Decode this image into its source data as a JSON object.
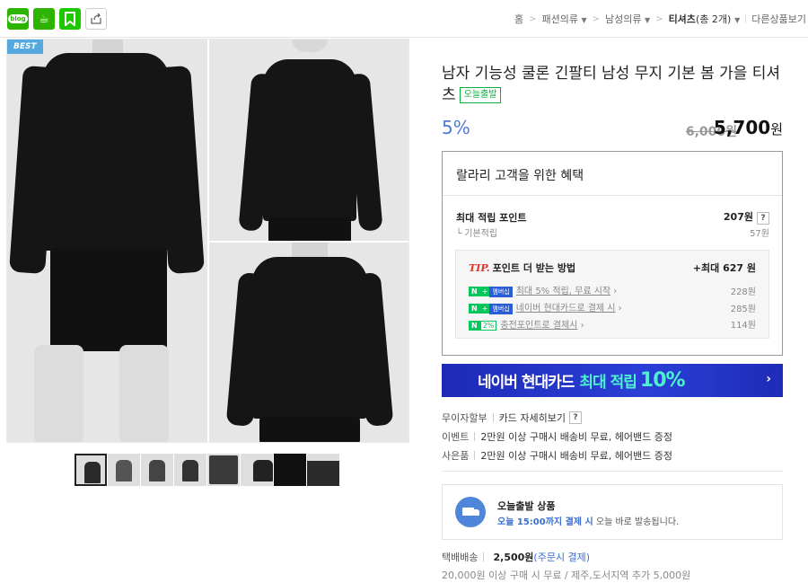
{
  "share": {
    "blog_label": "blog"
  },
  "breadcrumb": {
    "home": "홈",
    "cat1": "패션의류",
    "cat2": "남성의류",
    "cat3": "티셔츠",
    "count": "(총 2개)",
    "other": "다른상품보기"
  },
  "gallery": {
    "badge": "BEST",
    "thumb_count": 8
  },
  "product": {
    "title": "남자 기능성 쿨론 긴팔티 남성 무지 기본 봄 가을 티셔츠",
    "today_badge": "오늘출발",
    "discount": "5%",
    "original_price": "6,000원",
    "price": "5,700",
    "price_unit": "원"
  },
  "benefit": {
    "heading": "랄라리 고객을 위한 혜택",
    "max_points_label": "최대 적립 포인트",
    "max_points_value": "207원",
    "basic_label": "기본적립",
    "basic_value": "57원",
    "tip_label": "TIP.",
    "tip_text": "포인트 더 받는 방법",
    "tip_max": "+최대 627 원",
    "rows": [
      {
        "n": "N",
        "plus": "+",
        "tag": "멤버십",
        "text": "최대 5% 적립, 무료 시작",
        "value": "228원"
      },
      {
        "n": "N",
        "plus": "+",
        "tag": "멤버십",
        "text": "네이버 현대카드로 결제 시",
        "value": "285원"
      },
      {
        "n": "N",
        "tag": "2%",
        "text": "충전포인트로 결제시",
        "value": "114원"
      }
    ]
  },
  "card_banner": {
    "text": "네이버 현대카드",
    "highlight": "최대 적립",
    "percent": "10%"
  },
  "meta": {
    "installment": "무이자할부",
    "card_detail": "카드 자세히보기",
    "event_label": "이벤트",
    "event_text": "2만원 이상 구매시 배송비 무료, 헤어밴드 증정",
    "gift_label": "사은품",
    "gift_text": "2만원 이상 구매시 배송비 무료, 헤어밴드 증정"
  },
  "today_ship": {
    "title": "오늘출발 상품",
    "time": "오늘 15:00까지 결제 시",
    "rest": "오늘 바로 발송됩니다."
  },
  "shipping": {
    "label": "택배배송",
    "fee": "2,500원",
    "pay": "(주문시 결제)",
    "note": "20,000원 이상 구매 시 무료 / 제주,도서지역 추가 5,000원"
  },
  "colors": {
    "accent_blue": "#4f7ad6",
    "naver_green": "#03c75a",
    "card_banner": "#1f2bb8"
  }
}
